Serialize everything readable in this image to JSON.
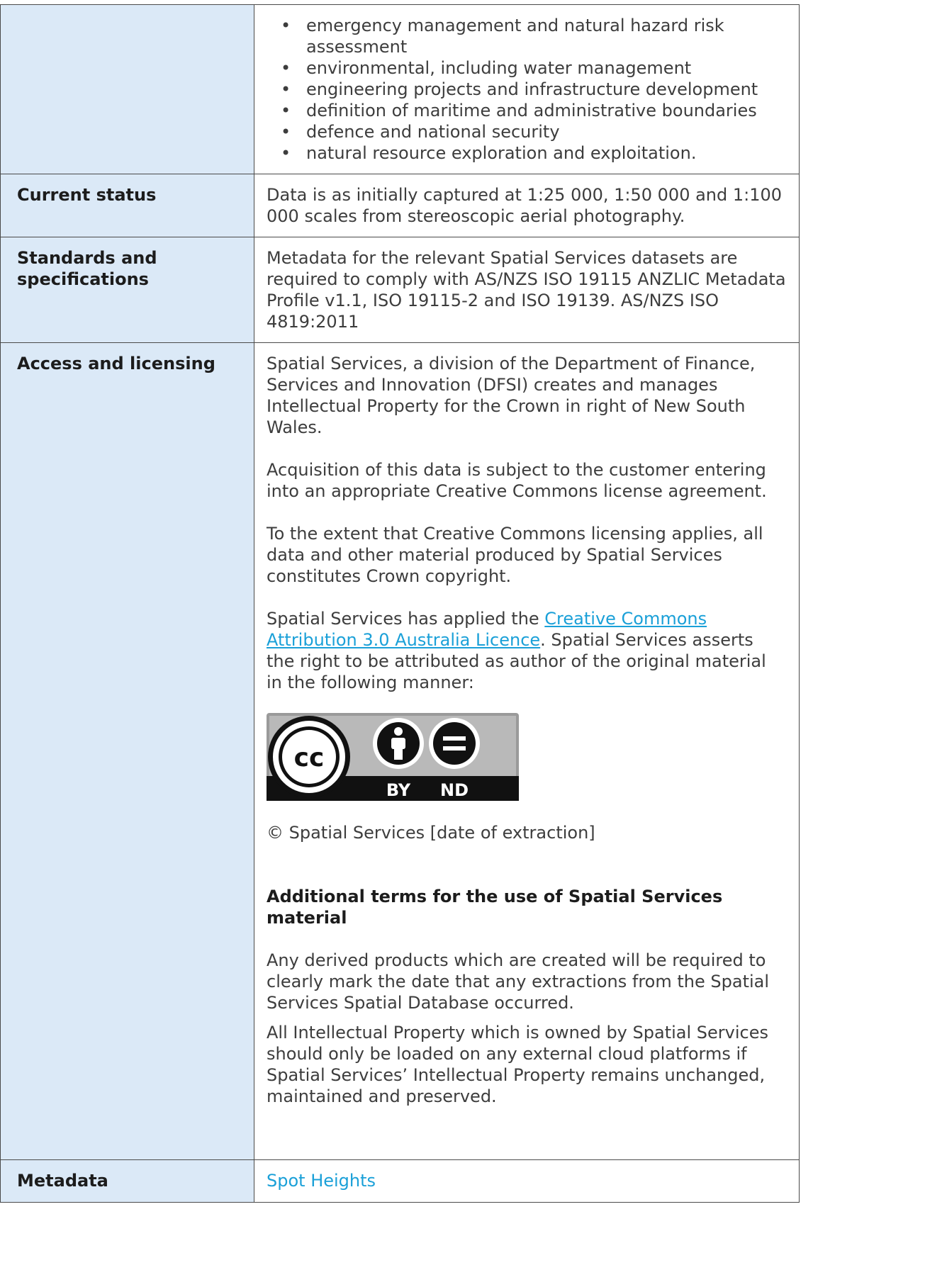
{
  "usage_bullets": [
    "emergency management and natural hazard risk assessment",
    "environmental, including water management",
    "engineering projects and infrastructure development",
    "definition of maritime and administrative boundaries",
    "defence and national security",
    "natural resource exploration and exploitation."
  ],
  "current_status": {
    "label": "Current status",
    "text": "Data is as initially captured at 1:25 000, 1:50 000 and 1:100 000 scales from stereoscopic aerial photography."
  },
  "standards": {
    "label": "Standards and specifications",
    "text": "Metadata for the relevant Spatial Services datasets are required to comply with AS/NZS ISO 19115 ANZLIC Metadata Profile v1.1, ISO 19115-2 and ISO 19139. AS/NZS ISO 4819:2011"
  },
  "access": {
    "label": "Access and licensing",
    "para1": "Spatial Services, a division of the Department of Finance, Services and Innovation (DFSI) creates and manages Intellectual Property for the Crown in right of New South Wales.",
    "para2": "Acquisition of this data is subject to the customer entering into an appropriate Creative Commons license agreement.",
    "para3": "To the extent that Creative Commons licensing applies, all data and other material produced by Spatial Services constitutes Crown copyright.",
    "para4_prefix": "Spatial Services has applied the ",
    "para4_link": "Creative Commons Attribution 3.0 Australia Licence",
    "para4_suffix": ". Spatial Services asserts the right to be attributed as author of the original material in the following manner:",
    "cc_badge": {
      "left": "BY",
      "right": "ND",
      "cc": "cc"
    },
    "copyright": "© Spatial Services [date of extraction]",
    "subheading": "Additional terms for the use of Spatial Services material",
    "para5": "Any derived products which are created will be required to clearly mark the date that any extractions from the Spatial Services Spatial Database occurred.",
    "para6": "All Intellectual Property which is owned by Spatial Services should only be loaded on any external cloud platforms if Spatial Services’ Intellectual Property remains unchanged, maintained and preserved."
  },
  "metadata": {
    "label": "Metadata",
    "link": "Spot Heights"
  },
  "colors": {
    "label_bg": "#dbe9f7",
    "link": "#1aa0d8",
    "border": "#4a4a4a"
  }
}
